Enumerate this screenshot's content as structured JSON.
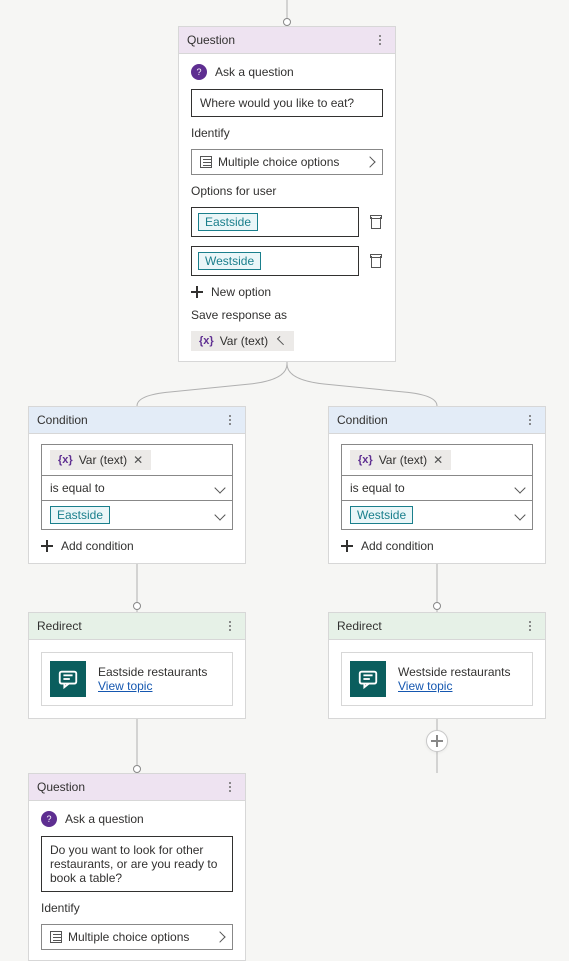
{
  "question1": {
    "header": "Question",
    "subtitle": "Ask a question",
    "prompt": "Where would you like to eat?",
    "identify_label": "Identify",
    "identify_value": "Multiple choice options",
    "options_label": "Options for user",
    "options": [
      "Eastside",
      "Westside"
    ],
    "new_option": "New option",
    "save_as_label": "Save response as",
    "var_prefix": "{x}",
    "var_text": "Var (text)"
  },
  "condition_left": {
    "header": "Condition",
    "var_prefix": "{x}",
    "var_text": "Var (text)",
    "operator": "is equal to",
    "value": "Eastside",
    "add_condition": "Add condition"
  },
  "condition_right": {
    "header": "Condition",
    "var_prefix": "{x}",
    "var_text": "Var (text)",
    "operator": "is equal to",
    "value": "Westside",
    "add_condition": "Add condition"
  },
  "redirect_left": {
    "header": "Redirect",
    "title": "Eastside restaurants",
    "link": "View topic"
  },
  "redirect_right": {
    "header": "Redirect",
    "title": "Westside restaurants",
    "link": "View topic"
  },
  "question2": {
    "header": "Question",
    "subtitle": "Ask a question",
    "prompt": "Do you want to look for other restaurants, or are you ready to book a table?",
    "identify_label": "Identify",
    "identify_value": "Multiple choice options"
  }
}
